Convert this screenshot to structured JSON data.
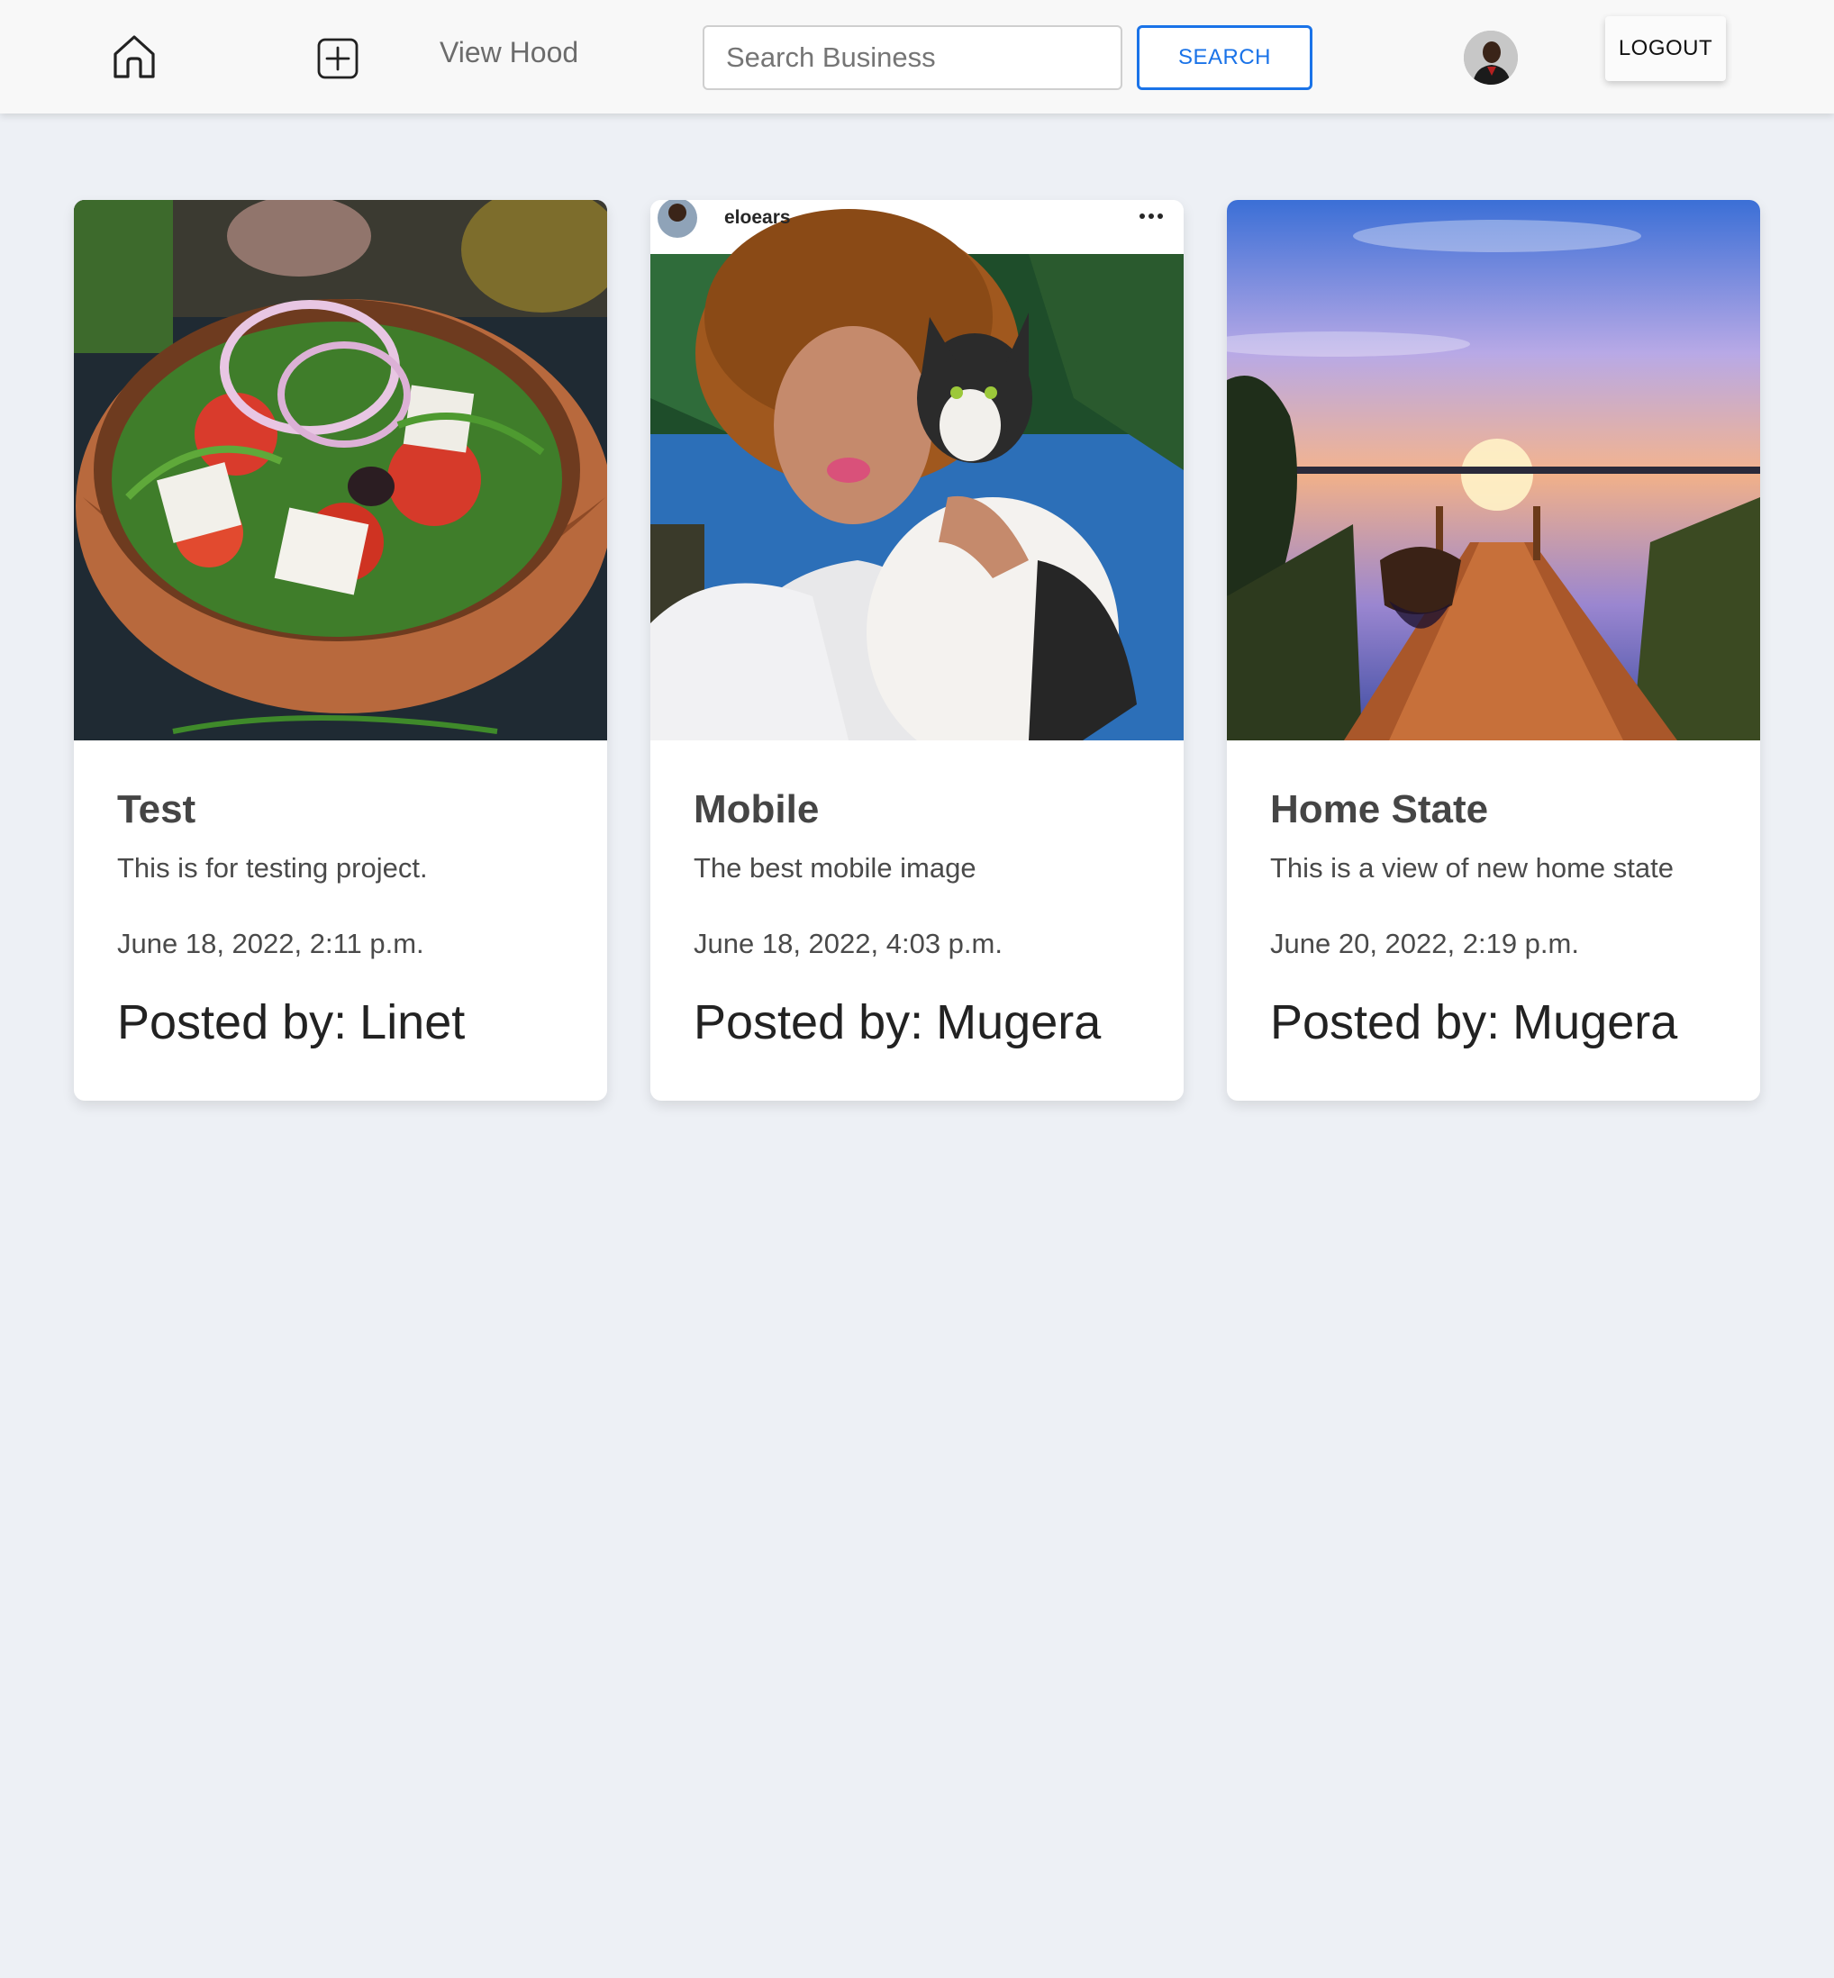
{
  "navbar": {
    "home_icon": "home-icon",
    "add_icon": "plus-square-icon",
    "view_hood_label": "View Hood",
    "search": {
      "placeholder": "Search Business",
      "value": ""
    },
    "search_button_label": "SEARCH",
    "logout_label": "LOGOUT"
  },
  "posts": [
    {
      "title": "Test",
      "description": "This is for testing project.",
      "date": "June 18, 2022, 2:11 p.m.",
      "posted_by_label": "Posted by:",
      "author": "Linet"
    },
    {
      "title": "Mobile",
      "description": "The best mobile image",
      "date": "June 18, 2022, 4:03 p.m.",
      "posted_by_label": "Posted by:",
      "author": "Mugera",
      "image_username": "eloears"
    },
    {
      "title": "Home State",
      "description": "This is a view of new home state",
      "date": "June 20, 2022, 2:19 p.m.",
      "posted_by_label": "Posted by:",
      "author": "Mugera"
    }
  ],
  "colors": {
    "page_background": "#edf0f5",
    "navbar_background": "#f8f8f8",
    "accent": "#1a73e8"
  }
}
